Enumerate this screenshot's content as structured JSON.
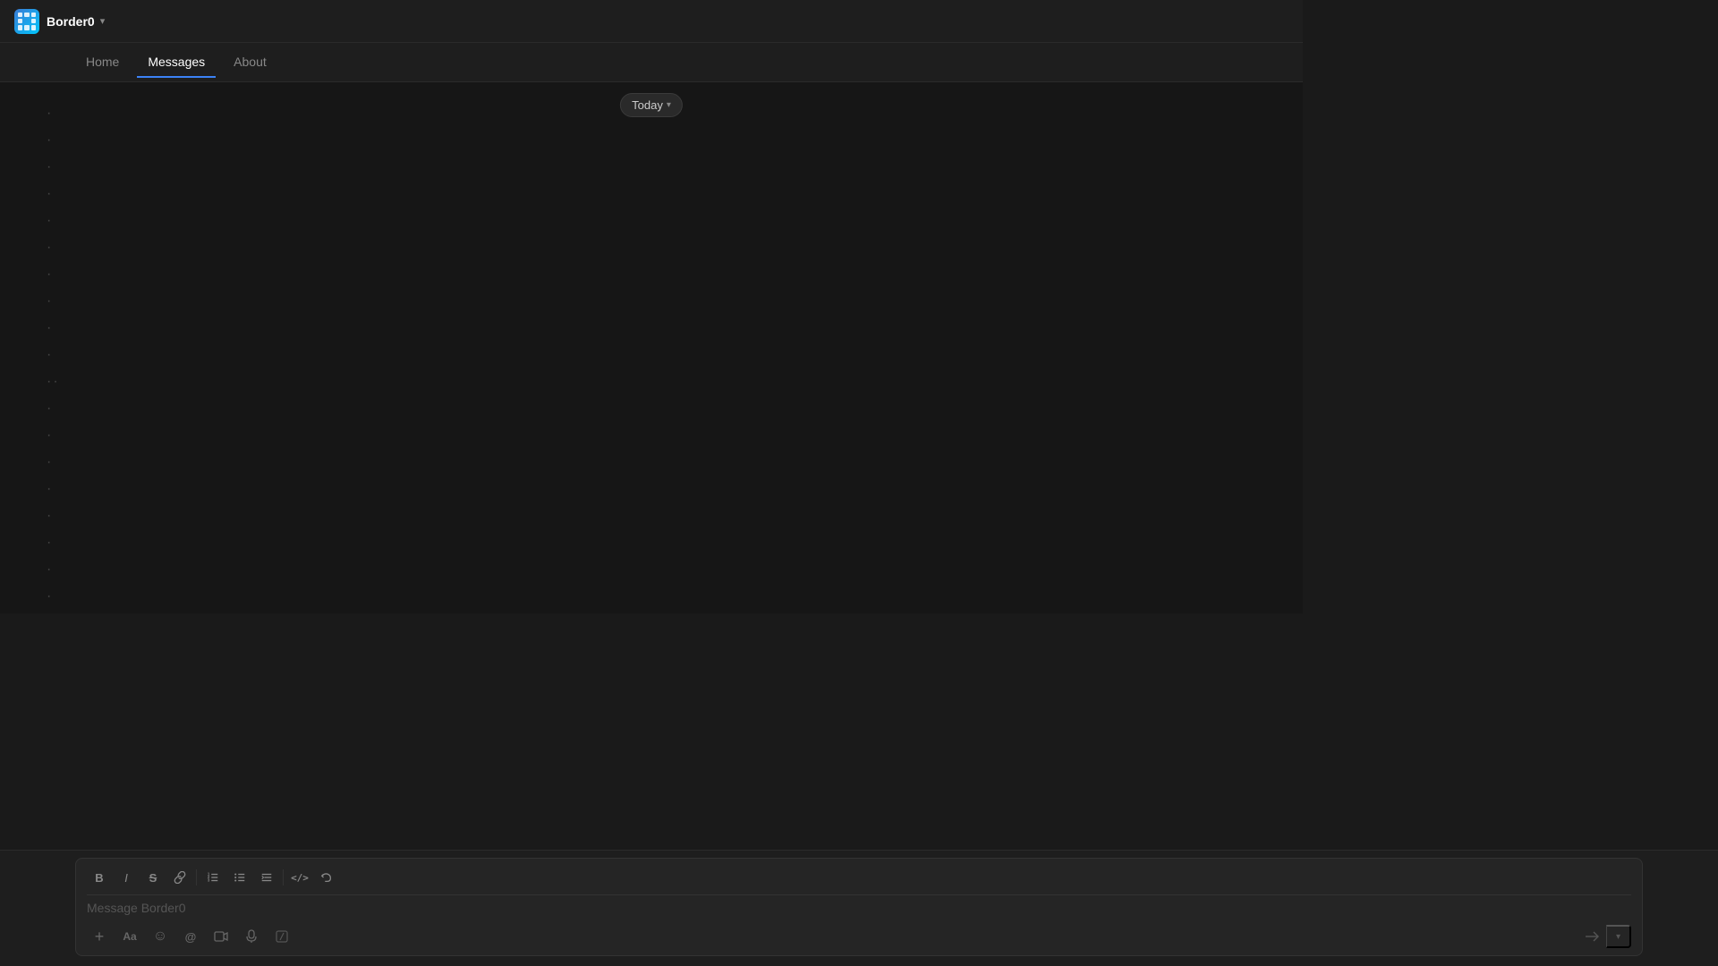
{
  "app": {
    "name": "Border0",
    "chevron": "▾"
  },
  "nav": {
    "tabs": [
      {
        "id": "home",
        "label": "Home",
        "active": false
      },
      {
        "id": "messages",
        "label": "Messages",
        "active": true
      },
      {
        "id": "about",
        "label": "About",
        "active": false
      }
    ]
  },
  "filter": {
    "label": "Today",
    "chevron": "▾"
  },
  "dots": [
    "·",
    "·",
    "·",
    "·",
    "·",
    "·",
    "·",
    "·",
    "·",
    "·",
    "··",
    "·",
    "·",
    "·",
    "·",
    "·",
    "·",
    "·",
    "·",
    "·",
    "·",
    "·",
    "·"
  ],
  "composer": {
    "placeholder": "Message Border0",
    "toolbar": {
      "bold": "B",
      "italic": "I",
      "strikethrough": "S",
      "link": "🔗",
      "ordered_list": "ol",
      "unordered_list": "ul",
      "increase_indent": "↑",
      "code": "</>",
      "undo": "↩"
    },
    "actions": {
      "add": "+",
      "text_style": "Aa",
      "emoji": "☺",
      "mention": "@",
      "video": "▶",
      "mic": "🎙",
      "slash": "/"
    }
  }
}
